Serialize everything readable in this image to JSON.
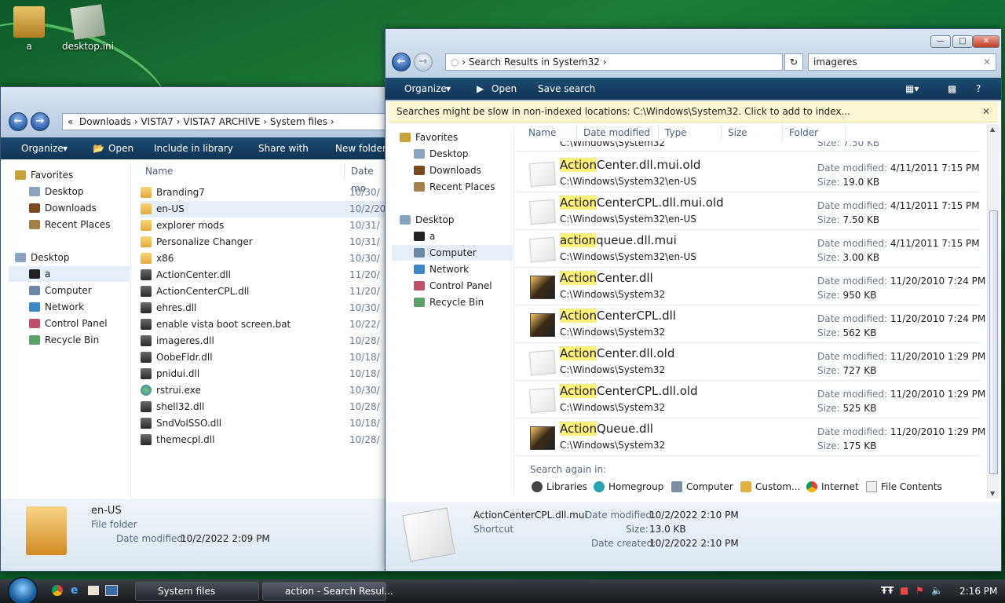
{
  "desktop": {
    "icons": [
      {
        "label": "a"
      },
      {
        "label": "desktop.ini"
      }
    ]
  },
  "win1": {
    "breadcrumb": [
      "Downloads",
      "VISTA7",
      "VISTA7 ARCHIVE",
      "System files"
    ],
    "breadcrumb_prefix": "«",
    "toolbar": {
      "organize": "Organize",
      "open": "Open",
      "include": "Include in library",
      "share": "Share with",
      "newfolder": "New folder"
    },
    "tree": {
      "favorites": "Favorites",
      "desktop": "Desktop",
      "downloads": "Downloads",
      "recent": "Recent Places",
      "desktop2": "Desktop",
      "a": "a",
      "computer": "Computer",
      "network": "Network",
      "control": "Control Panel",
      "recycle": "Recycle Bin"
    },
    "columns": {
      "name": "Name",
      "date": "Date mo"
    },
    "files": [
      {
        "name": "Branding7",
        "date": "10/30/",
        "type": "folder"
      },
      {
        "name": "en-US",
        "date": "10/2/20",
        "type": "folder"
      },
      {
        "name": "explorer mods",
        "date": "10/31/",
        "type": "folder"
      },
      {
        "name": "Personalize Changer",
        "date": "10/31/",
        "type": "folder"
      },
      {
        "name": "x86",
        "date": "10/30/",
        "type": "folder"
      },
      {
        "name": "ActionCenter.dll",
        "date": "11/20/",
        "type": "dll"
      },
      {
        "name": "ActionCenterCPL.dll",
        "date": "11/20/",
        "type": "dll"
      },
      {
        "name": "ehres.dll",
        "date": "10/30/",
        "type": "dll"
      },
      {
        "name": "enable vista boot screen.bat",
        "date": "10/22/",
        "type": "dll"
      },
      {
        "name": "imageres.dll",
        "date": "10/28/",
        "type": "dll"
      },
      {
        "name": "OobeFldr.dll",
        "date": "10/18/",
        "type": "dll"
      },
      {
        "name": "pnidui.dll",
        "date": "10/18/",
        "type": "dll"
      },
      {
        "name": "rstrui.exe",
        "date": "10/30/",
        "type": "exe"
      },
      {
        "name": "shell32.dll",
        "date": "10/28/",
        "type": "dll"
      },
      {
        "name": "SndVolSSO.dll",
        "date": "10/18/",
        "type": "dll"
      },
      {
        "name": "themecpl.dll",
        "date": "10/28/",
        "type": "dll"
      }
    ],
    "details": {
      "name": "en-US",
      "type": "File folder",
      "modified_label": "Date modified:",
      "modified": "10/2/2022 2:09 PM"
    }
  },
  "win2": {
    "address": "Search Results in System32",
    "search_value": "imageres",
    "toolbar": {
      "organize": "Organize",
      "open": "Open",
      "save": "Save search"
    },
    "infobar": "Searches might be slow in non-indexed locations: C:\\Windows\\System32. Click to add to index...",
    "tree": {
      "favorites": "Favorites",
      "desktop": "Desktop",
      "downloads": "Downloads",
      "recent": "Recent Places",
      "desktop2": "Desktop",
      "a": "a",
      "computer": "Computer",
      "network": "Network",
      "control": "Control Panel",
      "recycle": "Recycle Bin"
    },
    "columns": {
      "name": "Name",
      "date": "Date modified",
      "type": "Type",
      "size": "Size",
      "folder": "Folder"
    },
    "partial_path": "C:\\Windows\\System32",
    "partial_size": "Size: 7.50 KB",
    "labels": {
      "date": "Date modified:",
      "size": "Size:"
    },
    "results": [
      {
        "hl": "Action",
        "rest": "Center.dll.mui.old",
        "path": "C:\\Windows\\System32\\en-US",
        "date": "4/11/2011 7:15 PM",
        "size": "19.0 KB",
        "kind": "page"
      },
      {
        "hl": "Action",
        "rest": "CenterCPL.dll.mui.old",
        "path": "C:\\Windows\\System32\\en-US",
        "date": "4/11/2011 7:15 PM",
        "size": "7.50 KB",
        "kind": "page"
      },
      {
        "hl": "action",
        "rest": "queue.dll.mui",
        "path": "C:\\Windows\\System32\\en-US",
        "date": "4/11/2011 7:15 PM",
        "size": "3.00 KB",
        "kind": "page"
      },
      {
        "hl": "Action",
        "rest": "Center.dll",
        "path": "C:\\Windows\\System32",
        "date": "11/20/2010 7:24 PM",
        "size": "950 KB",
        "kind": "dll"
      },
      {
        "hl": "Action",
        "rest": "CenterCPL.dll",
        "path": "C:\\Windows\\System32",
        "date": "11/20/2010 7:24 PM",
        "size": "562 KB",
        "kind": "dll"
      },
      {
        "hl": "Action",
        "rest": "Center.dll.old",
        "path": "C:\\Windows\\System32",
        "date": "11/20/2010 1:29 PM",
        "size": "727 KB",
        "kind": "page"
      },
      {
        "hl": "Action",
        "rest": "CenterCPL.dll.old",
        "path": "C:\\Windows\\System32",
        "date": "11/20/2010 1:29 PM",
        "size": "525 KB",
        "kind": "page"
      },
      {
        "hl": "Action",
        "rest": "Queue.dll",
        "path": "C:\\Windows\\System32",
        "date": "11/20/2010 1:29 PM",
        "size": "175 KB",
        "kind": "dll"
      }
    ],
    "search_again": {
      "title": "Search again in:",
      "items": [
        "Libraries",
        "Homegroup",
        "Computer",
        "Custom...",
        "Internet",
        "File Contents"
      ]
    },
    "details": {
      "name": "ActionCenterCPL.dll.mui",
      "type": "Shortcut",
      "modified_label": "Date modified:",
      "modified": "10/2/2022 2:10 PM",
      "size_label": "Size:",
      "size": "13.0 KB",
      "created_label": "Date created:",
      "created": "10/2/2022 2:10 PM"
    }
  },
  "taskbar": {
    "buttons": [
      "System files",
      "action - Search Resul..."
    ],
    "time": "2:16 PM"
  }
}
